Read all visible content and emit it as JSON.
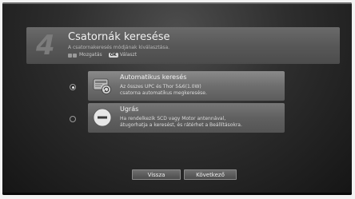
{
  "header": {
    "step": "4",
    "title": "Csatornák keresése",
    "subtitle": "A csatornakeresés módjának kiválasztása.",
    "hint_move": "Mozgatás",
    "hint_ok_key": "OK",
    "hint_select": "Választ"
  },
  "options": [
    {
      "title": "Automatikus keresés",
      "desc_line1": "Az összes UPC és Thor 5&6(1.0W)",
      "desc_line2": "csatorna automatikus megkeresése.",
      "icon": "satellite-search-icon",
      "selected": true
    },
    {
      "title": "Ugrás",
      "desc_line1": "Ha rendelkezik SCD vagy Motor antennával,",
      "desc_line2": "átugorhatja a keresést, és rátérhet a Beállításokra.",
      "icon": "skip-icon",
      "selected": false
    }
  ],
  "buttons": {
    "back": "Vissza",
    "next": "Következő"
  }
}
